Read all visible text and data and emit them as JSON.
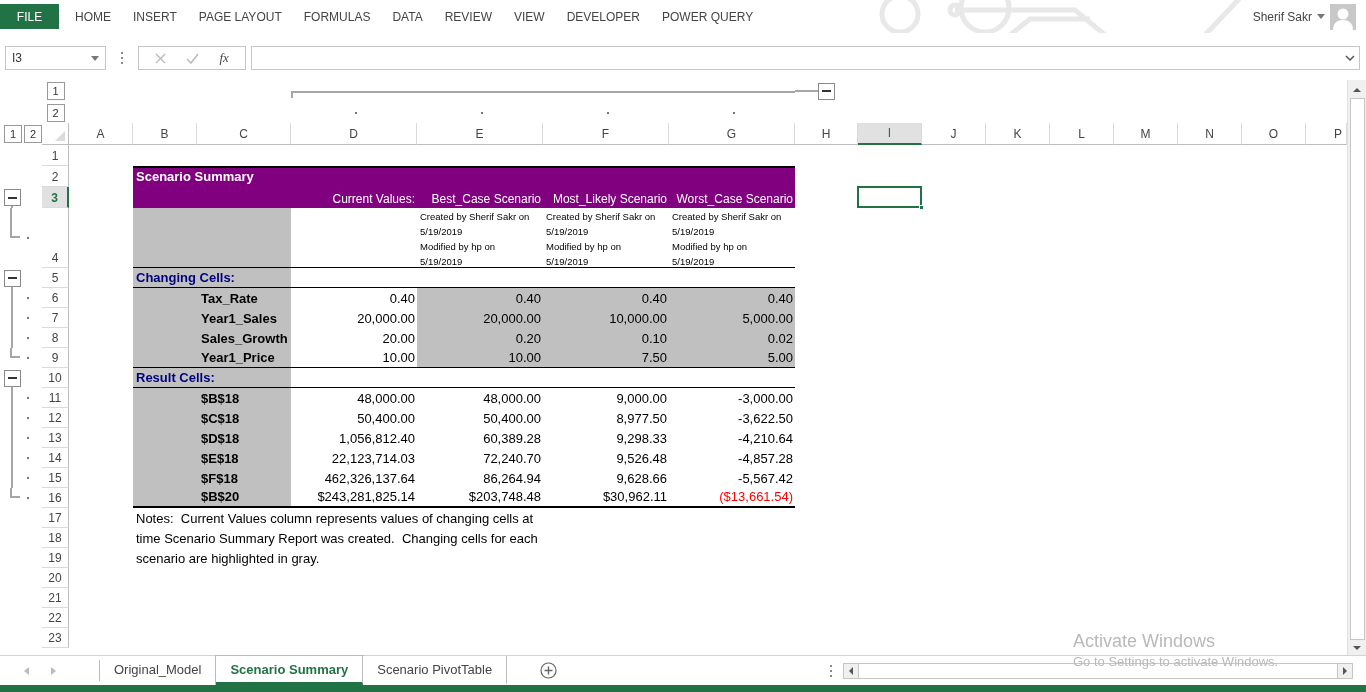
{
  "ribbon": {
    "file_button": "FILE",
    "tabs": [
      "HOME",
      "INSERT",
      "PAGE LAYOUT",
      "FORMULAS",
      "DATA",
      "REVIEW",
      "VIEW",
      "DEVELOPER",
      "POWER QUERY"
    ],
    "user_name": "Sherif Sakr"
  },
  "formula_bar": {
    "name_box": "I3",
    "function_symbol": "fx"
  },
  "outline_levels": {
    "columns": [
      "1",
      "2"
    ],
    "rows": [
      "1",
      "2"
    ]
  },
  "columns": [
    {
      "label": "A",
      "selected": false,
      "grouped": false,
      "collapse_button": false
    },
    {
      "label": "B",
      "selected": false,
      "grouped": false,
      "collapse_button": false
    },
    {
      "label": "C",
      "selected": false,
      "grouped": false,
      "collapse_button": false
    },
    {
      "label": "D",
      "selected": false,
      "grouped": true,
      "collapse_button": false
    },
    {
      "label": "E",
      "selected": false,
      "grouped": true,
      "collapse_button": false
    },
    {
      "label": "F",
      "selected": false,
      "grouped": true,
      "collapse_button": false
    },
    {
      "label": "G",
      "selected": false,
      "grouped": true,
      "collapse_button": false
    },
    {
      "label": "H",
      "selected": false,
      "grouped": false,
      "collapse_button": true
    },
    {
      "label": "I",
      "selected": true,
      "grouped": false,
      "collapse_button": false
    },
    {
      "label": "J",
      "selected": false,
      "grouped": false,
      "collapse_button": false
    },
    {
      "label": "K",
      "selected": false,
      "grouped": false,
      "collapse_button": false
    },
    {
      "label": "L",
      "selected": false,
      "grouped": false,
      "collapse_button": false
    },
    {
      "label": "M",
      "selected": false,
      "grouped": false,
      "collapse_button": false
    },
    {
      "label": "N",
      "selected": false,
      "grouped": false,
      "collapse_button": false
    },
    {
      "label": "O",
      "selected": false,
      "grouped": false,
      "collapse_button": false
    },
    {
      "label": "P",
      "selected": false,
      "grouped": false,
      "collapse_button": false
    }
  ],
  "rows": [
    {
      "number": "1",
      "selected": false,
      "collapse_button": false,
      "grouped": false
    },
    {
      "number": "2",
      "selected": false,
      "collapse_button": false,
      "grouped": false
    },
    {
      "number": "3",
      "selected": true,
      "collapse_button": true,
      "grouped": false
    },
    {
      "number": "4",
      "selected": false,
      "collapse_button": false,
      "grouped": true
    },
    {
      "number": "5",
      "selected": false,
      "collapse_button": true,
      "grouped": false
    },
    {
      "number": "6",
      "selected": false,
      "collapse_button": false,
      "grouped": true
    },
    {
      "number": "7",
      "selected": false,
      "collapse_button": false,
      "grouped": true
    },
    {
      "number": "8",
      "selected": false,
      "collapse_button": false,
      "grouped": true
    },
    {
      "number": "9",
      "selected": false,
      "collapse_button": false,
      "grouped": true
    },
    {
      "number": "10",
      "selected": false,
      "collapse_button": true,
      "grouped": false
    },
    {
      "number": "11",
      "selected": false,
      "collapse_button": false,
      "grouped": true
    },
    {
      "number": "12",
      "selected": false,
      "collapse_button": false,
      "grouped": true
    },
    {
      "number": "13",
      "selected": false,
      "collapse_button": false,
      "grouped": true
    },
    {
      "number": "14",
      "selected": false,
      "collapse_button": false,
      "grouped": true
    },
    {
      "number": "15",
      "selected": false,
      "collapse_button": false,
      "grouped": true
    },
    {
      "number": "16",
      "selected": false,
      "collapse_button": false,
      "grouped": true
    },
    {
      "number": "17",
      "selected": false,
      "collapse_button": false,
      "grouped": false
    },
    {
      "number": "18",
      "selected": false,
      "collapse_button": false,
      "grouped": false
    },
    {
      "number": "19",
      "selected": false,
      "collapse_button": false,
      "grouped": false
    },
    {
      "number": "20",
      "selected": false,
      "collapse_button": false,
      "grouped": false
    },
    {
      "number": "21",
      "selected": false,
      "collapse_button": false,
      "grouped": false
    },
    {
      "number": "22",
      "selected": false,
      "collapse_button": false,
      "grouped": false
    },
    {
      "number": "23",
      "selected": false,
      "collapse_button": false,
      "grouped": false
    }
  ],
  "report": {
    "title": "Scenario Summary",
    "column_headers": [
      "Current Values:",
      "Best_Case Scenario",
      "Most_Likely Scenario",
      "Worst_Case Scenario"
    ],
    "scenario_notes": [
      {
        "lines": [
          "Created by Sherif Sakr on",
          "5/19/2019",
          "Modified by hp on",
          "5/19/2019"
        ]
      },
      {
        "lines": [
          "Created by Sherif Sakr on",
          "5/19/2019",
          "Modified by hp on",
          "5/19/2019"
        ]
      },
      {
        "lines": [
          "Created by Sherif Sakr on",
          "5/19/2019",
          "Modified by hp on",
          "5/19/2019"
        ]
      }
    ],
    "sections": [
      {
        "title": "Changing Cells:",
        "highlight_scenarios": true,
        "rows": [
          {
            "label": "Tax_Rate",
            "values": [
              {
                "text": "0.40",
                "negative": false
              },
              {
                "text": "0.40",
                "negative": false
              },
              {
                "text": "0.40",
                "negative": false
              },
              {
                "text": "0.40",
                "negative": false
              }
            ]
          },
          {
            "label": "Year1_Sales",
            "values": [
              {
                "text": "20,000.00",
                "negative": false
              },
              {
                "text": "20,000.00",
                "negative": false
              },
              {
                "text": "10,000.00",
                "negative": false
              },
              {
                "text": "5,000.00",
                "negative": false
              }
            ]
          },
          {
            "label": "Sales_Growth",
            "values": [
              {
                "text": "20.00",
                "negative": false
              },
              {
                "text": "0.20",
                "negative": false
              },
              {
                "text": "0.10",
                "negative": false
              },
              {
                "text": "0.02",
                "negative": false
              }
            ]
          },
          {
            "label": "Year1_Price",
            "values": [
              {
                "text": "10.00",
                "negative": false
              },
              {
                "text": "10.00",
                "negative": false
              },
              {
                "text": "7.50",
                "negative": false
              },
              {
                "text": "5.00",
                "negative": false
              }
            ]
          }
        ]
      },
      {
        "title": "Result Cells:",
        "highlight_scenarios": false,
        "rows": [
          {
            "label": "$B$18",
            "values": [
              {
                "text": "48,000.00",
                "negative": false
              },
              {
                "text": "48,000.00",
                "negative": false
              },
              {
                "text": "9,000.00",
                "negative": false
              },
              {
                "text": "-3,000.00",
                "negative": false
              }
            ]
          },
          {
            "label": "$C$18",
            "values": [
              {
                "text": "50,400.00",
                "negative": false
              },
              {
                "text": "50,400.00",
                "negative": false
              },
              {
                "text": "8,977.50",
                "negative": false
              },
              {
                "text": "-3,622.50",
                "negative": false
              }
            ]
          },
          {
            "label": "$D$18",
            "values": [
              {
                "text": "1,056,812.40",
                "negative": false
              },
              {
                "text": "60,389.28",
                "negative": false
              },
              {
                "text": "9,298.33",
                "negative": false
              },
              {
                "text": "-4,210.64",
                "negative": false
              }
            ]
          },
          {
            "label": "$E$18",
            "values": [
              {
                "text": "22,123,714.03",
                "negative": false
              },
              {
                "text": "72,240.70",
                "negative": false
              },
              {
                "text": "9,526.48",
                "negative": false
              },
              {
                "text": "-4,857.28",
                "negative": false
              }
            ]
          },
          {
            "label": "$F$18",
            "values": [
              {
                "text": "462,326,137.64",
                "negative": false
              },
              {
                "text": "86,264.94",
                "negative": false
              },
              {
                "text": "9,628.66",
                "negative": false
              },
              {
                "text": "-5,567.42",
                "negative": false
              }
            ]
          },
          {
            "label": "$B$20",
            "values": [
              {
                "text": "$243,281,825.14",
                "negative": false
              },
              {
                "text": "$203,748.48",
                "negative": false
              },
              {
                "text": "$30,962.11",
                "negative": false
              },
              {
                "text": "($13,661.54)",
                "negative": true
              }
            ]
          }
        ]
      }
    ],
    "notes": [
      "Notes:  Current Values column represents values of changing cells at",
      "time Scenario Summary Report was created.  Changing cells for each",
      "scenario are highlighted in gray."
    ]
  },
  "sheet_tabs": [
    {
      "label": "Original_Model",
      "selected": false
    },
    {
      "label": "Scenario Summary",
      "selected": true
    },
    {
      "label": "Scenario PivotTable",
      "selected": false
    }
  ],
  "activation_notice": {
    "title": "Activate Windows",
    "hint": "Go to Settings to activate Windows."
  }
}
